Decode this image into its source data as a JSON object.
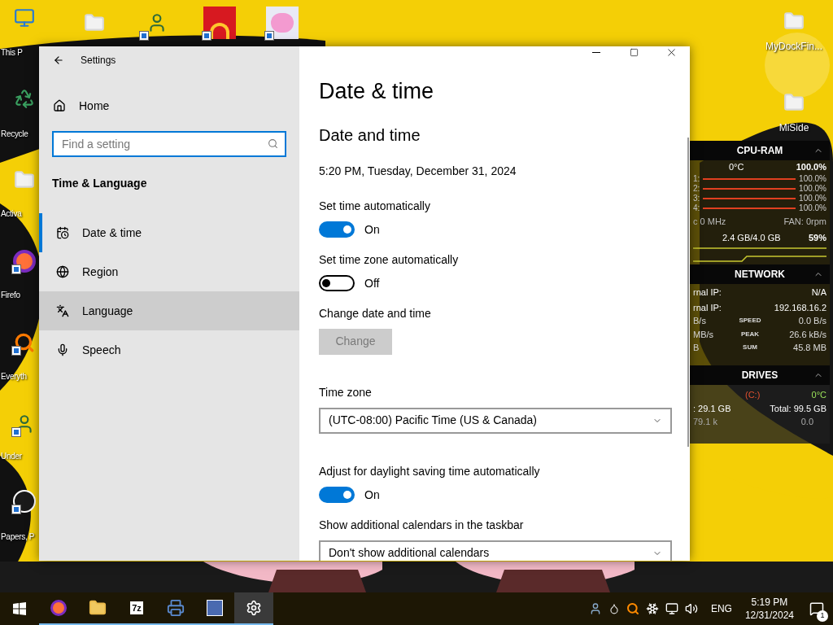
{
  "desktop": {
    "left_icons": [
      {
        "kind": "monitor",
        "label": "This P",
        "shortcut": false
      },
      {
        "kind": "recycle",
        "label": "Recycle",
        "shortcut": false
      },
      {
        "kind": "folder",
        "label": "Activa",
        "shortcut": false
      },
      {
        "kind": "firefox",
        "label": "Firefo",
        "shortcut": true
      },
      {
        "kind": "search",
        "label": "Everyth",
        "shortcut": true
      },
      {
        "kind": "character",
        "label": "Under",
        "shortcut": true
      },
      {
        "kind": "circle",
        "label": "Papers, P",
        "shortcut": true
      }
    ],
    "top_icons": [
      {
        "kind": "folder",
        "shortcut": false
      },
      {
        "kind": "character",
        "shortcut": true
      },
      {
        "kind": "arches",
        "shortcut": true
      },
      {
        "kind": "pig",
        "shortcut": true
      }
    ],
    "right_icons": [
      {
        "kind": "folder",
        "label": "MyDockFin..."
      },
      {
        "kind": "folder",
        "label": "MiSide"
      }
    ]
  },
  "settings": {
    "title": "Settings",
    "home": "Home",
    "search": {
      "placeholder": "Find a setting"
    },
    "section": "Time & Language",
    "nav": [
      {
        "kind": "calendar",
        "label": "Date & time",
        "selected": true,
        "hovered": false
      },
      {
        "kind": "globe",
        "label": "Region",
        "selected": false,
        "hovered": false
      },
      {
        "kind": "language",
        "label": "Language",
        "selected": false,
        "hovered": true
      },
      {
        "kind": "mic",
        "label": "Speech",
        "selected": false,
        "hovered": false
      }
    ],
    "page_title": "Date & time",
    "heading": "Date and time",
    "current": "5:20 PM, Tuesday, December 31, 2024",
    "items": [
      {
        "kind": "toggle",
        "label": "Set time automatically",
        "on": true,
        "state": "On"
      },
      {
        "kind": "toggle",
        "label": "Set time zone automatically",
        "on": false,
        "state": "Off"
      },
      {
        "kind": "button",
        "label": "Change date and time",
        "button": "Change",
        "disabled": true
      },
      {
        "kind": "dropdown",
        "label": "Time zone",
        "value": "(UTC-08:00) Pacific Time (US & Canada)"
      },
      {
        "kind": "toggle",
        "label": "Adjust for daylight saving time automatically",
        "on": true,
        "state": "On"
      },
      {
        "kind": "dropdown",
        "label": "Show additional calendars in the taskbar",
        "value": "Don't show additional calendars"
      }
    ]
  },
  "gadgets": {
    "cpu": {
      "title": "CPU-RAM",
      "temp": "0°C",
      "total": "100.0%",
      "cores": [
        {
          "label": "1:",
          "value": "100.0%",
          "level": 1
        },
        {
          "label": "2:",
          "value": "100.0%",
          "level": 1
        },
        {
          "label": "3:",
          "value": "100.0%",
          "level": 1
        },
        {
          "label": "4:",
          "value": "100.0%",
          "level": 1
        }
      ],
      "clock": "c 0 MHz",
      "fan": "FAN: 0rpm",
      "ram": "2.4 GB/4.0 GB",
      "ram_percent": "59%"
    },
    "network": {
      "title": "NETWORK",
      "rows": [
        {
          "label": "rnal IP:",
          "value": "N/A"
        },
        {
          "label": "rnal IP:",
          "value": "192.168.16.2"
        }
      ],
      "stats": [
        {
          "left": "B/s",
          "label": "SPEED",
          "value": "0.0 B/s"
        },
        {
          "left": "MB/s",
          "label": "PEAK",
          "value": "26.6 kB/s"
        },
        {
          "left": "B",
          "label": "SUM",
          "value": "45.8 MB"
        }
      ]
    },
    "drives": {
      "title": "DRIVES",
      "drive": "(C:)",
      "temp": "0°C",
      "free": ": 29.1 GB",
      "total": "Total: 99.5 GB",
      "read": "79.1 k",
      "write": "0.0"
    }
  },
  "taskbar": {
    "apps": [
      {
        "kind": "firefox",
        "running": true,
        "active": false
      },
      {
        "kind": "folder",
        "running": true,
        "active": false
      },
      {
        "kind": "archive",
        "label": "7z",
        "running": true,
        "active": false
      },
      {
        "kind": "printer",
        "running": true,
        "active": false
      },
      {
        "kind": "avatar",
        "running": true,
        "active": false
      },
      {
        "kind": "gear",
        "running": true,
        "active": true
      }
    ],
    "language": "ENG",
    "time": "5:19 PM",
    "date": "12/31/2024",
    "notifications": "1"
  }
}
